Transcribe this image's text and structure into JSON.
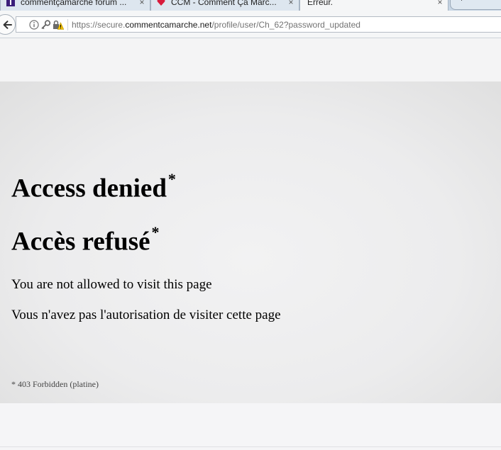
{
  "browser": {
    "tabs": [
      {
        "label": "commentçamarche forum ...",
        "icon": "ccm-forum-favicon",
        "close": "×"
      },
      {
        "label": "CCM - Comment Ça Marc...",
        "icon": "ccm-heart-favicon",
        "close": "×"
      },
      {
        "label": "Erreur.",
        "icon": "",
        "close": "×"
      }
    ],
    "extra_tab_label": "+",
    "url": {
      "scheme": "https://secure.",
      "host": "commentcamarche.net",
      "path": "/profile/user/Ch_62?password_updated"
    },
    "icons": {
      "back": "back-arrow-icon",
      "info": "info-icon",
      "key": "key-icon",
      "lock": "lock-warning-icon"
    }
  },
  "page": {
    "heading_en": "Access denied",
    "heading_fr": "Accès refusé",
    "asterisk": "*",
    "message_en": "You are not allowed to visit this page",
    "message_fr": "Vous n'avez pas l'autorisation de visiter cette page",
    "footnote": "* 403 Forbidden (platine)"
  },
  "colors": {
    "tabstrip": "#c8d6e5",
    "ccm_red": "#d81b3c",
    "forum_purple": "#3b1e7a",
    "warning_yellow": "#f2c200"
  }
}
